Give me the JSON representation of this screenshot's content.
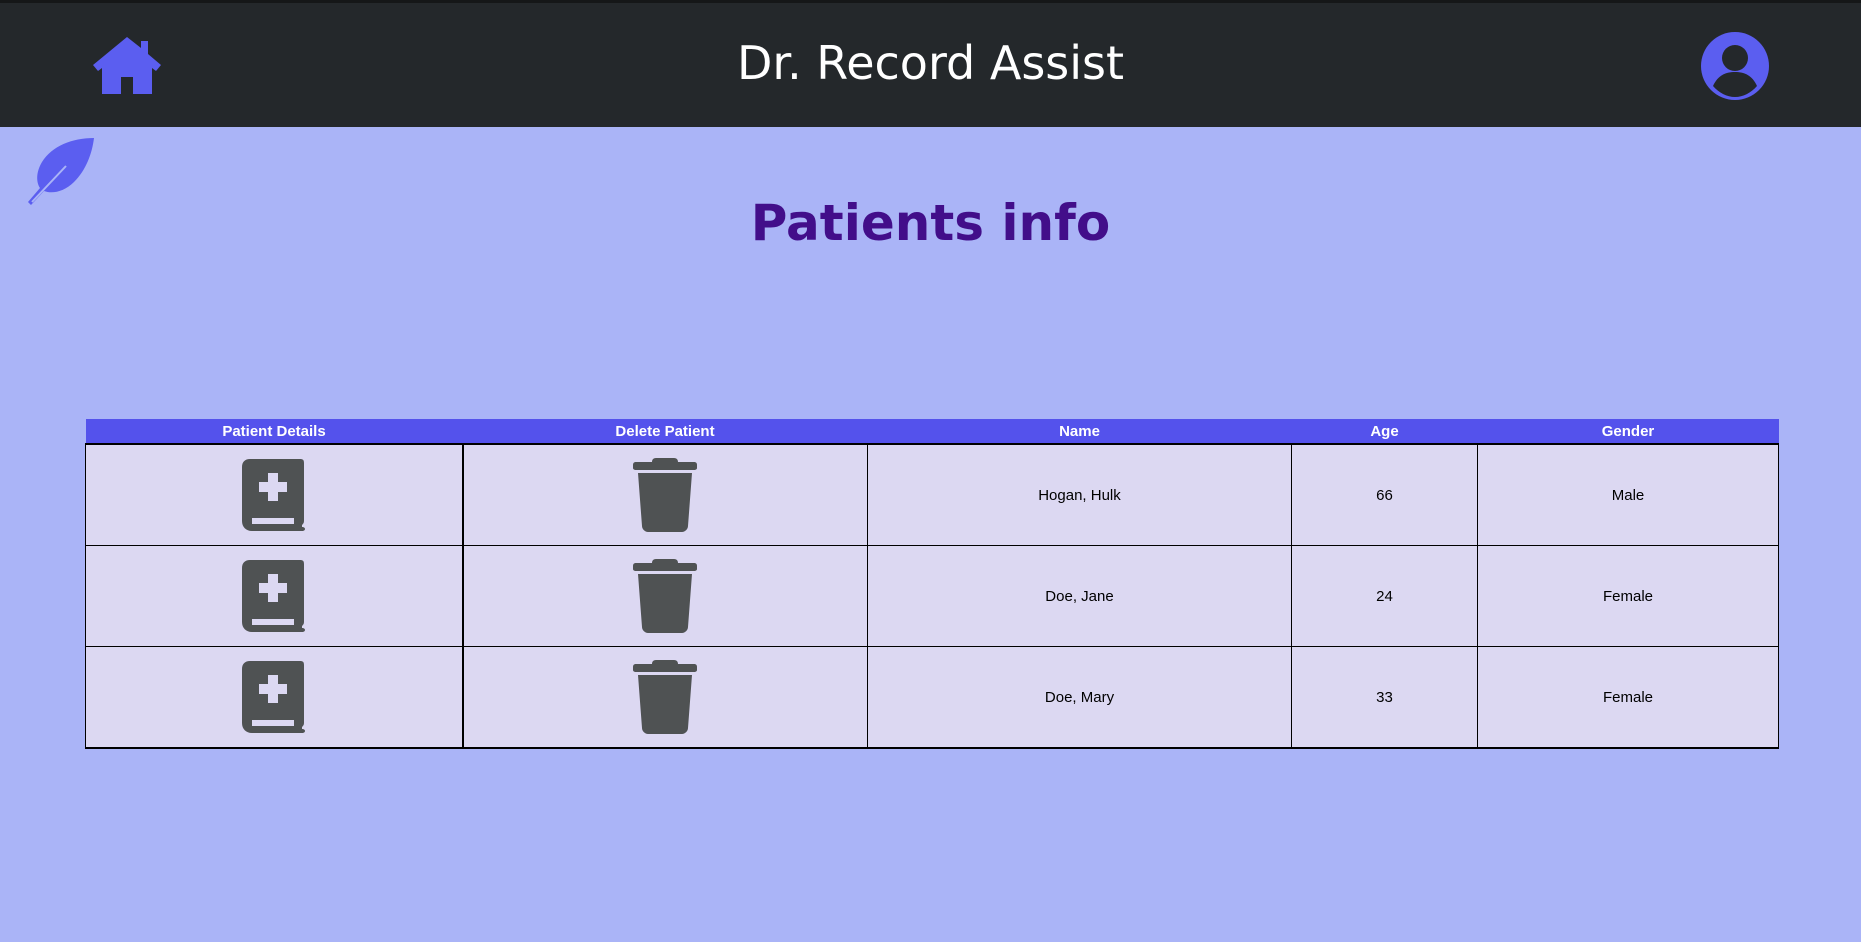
{
  "header": {
    "title": "Dr. Record Assist",
    "home_icon": "home-icon",
    "user_icon": "user-circle-icon",
    "accent": "#5b5ef0"
  },
  "page": {
    "title": "Patients info",
    "title_color": "#420e8a",
    "decor_icon": "feather-icon"
  },
  "table": {
    "header_bg": "#5452ec",
    "row_bg": "#dcd8f2",
    "columns": [
      "Patient Details",
      "Delete Patient",
      "Name",
      "Age",
      "Gender"
    ],
    "rows": [
      {
        "details_icon": "medical-book-icon",
        "delete_icon": "trash-icon",
        "name": "Hogan, Hulk",
        "age": "66",
        "gender": "Male"
      },
      {
        "details_icon": "medical-book-icon",
        "delete_icon": "trash-icon",
        "name": "Doe, Jane",
        "age": "24",
        "gender": "Female"
      },
      {
        "details_icon": "medical-book-icon",
        "delete_icon": "trash-icon",
        "name": "Doe, Mary",
        "age": "33",
        "gender": "Female"
      }
    ]
  }
}
